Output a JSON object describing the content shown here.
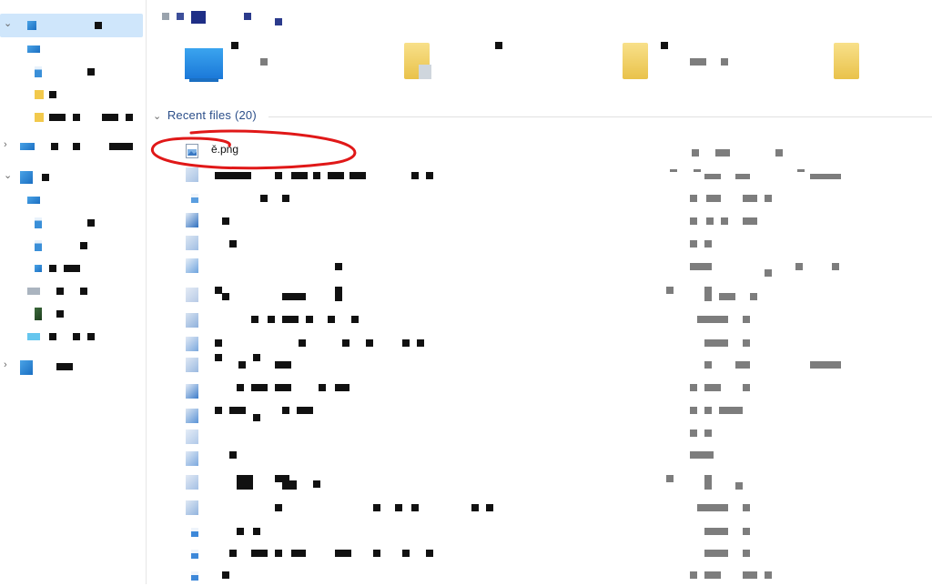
{
  "recent": {
    "header_label": "Recent files",
    "count_label": "(20)",
    "highlighted_file": {
      "name": "ě.png",
      "icon": "image-file-icon"
    }
  },
  "icons": {
    "expand": "chevron-down-icon",
    "collapse": "chevron-right-icon",
    "section_toggle": "chevron-down-icon"
  },
  "colors": {
    "selection": "#cfe6fb",
    "accent_blue": "#1b78d8",
    "folder_yellow": "#f2c94c",
    "annotation_red": "#e01818"
  }
}
